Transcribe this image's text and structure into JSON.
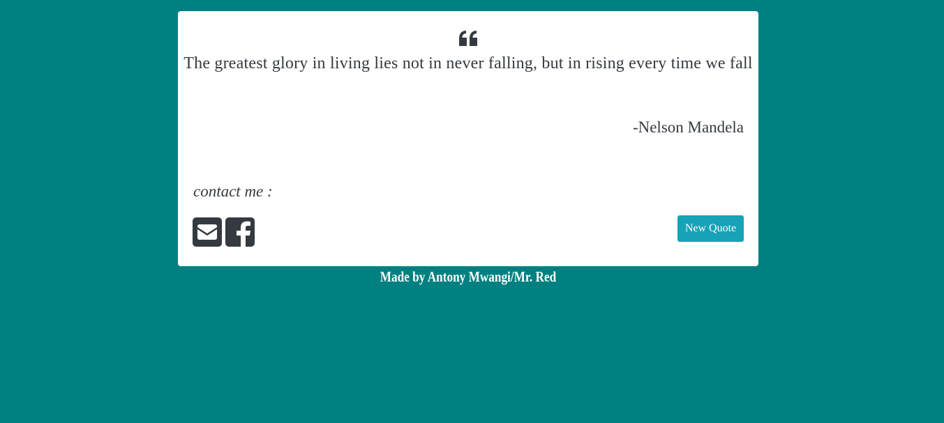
{
  "quote": {
    "text": "The greatest glory in living lies not in never falling, but in rising every time we fall",
    "author": "-Nelson Mandela"
  },
  "contact": {
    "label": "contact me :",
    "icons": [
      "envelope-square-icon",
      "facebook-square-icon"
    ]
  },
  "actions": {
    "new_quote_label": "New Quote"
  },
  "footer": {
    "credit": "Made by Antony Mwangi/Mr. Red"
  },
  "colors": {
    "background": "#008080",
    "card": "#ffffff",
    "text": "#343a40",
    "button": "#17a2b8"
  }
}
